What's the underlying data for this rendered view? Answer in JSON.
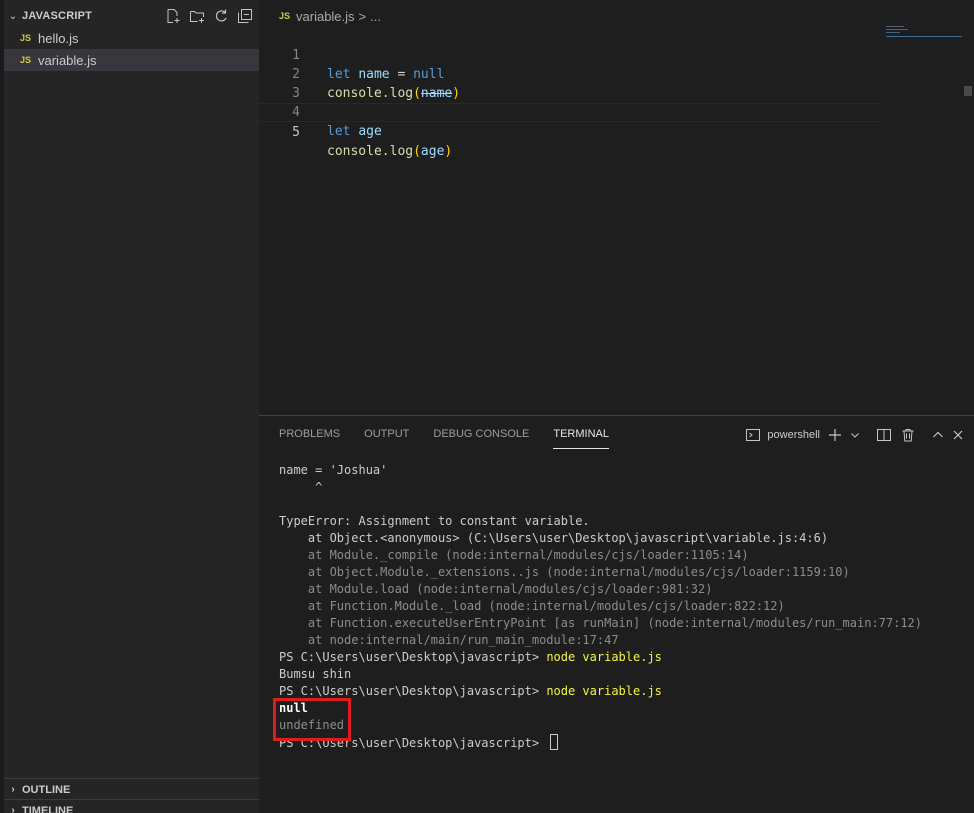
{
  "sidebar": {
    "header_title": "JAVASCRIPT",
    "files": [
      {
        "badge": "JS",
        "name": "hello.js"
      },
      {
        "badge": "JS",
        "name": "variable.js"
      }
    ],
    "outline_label": "OUTLINE",
    "timeline_label": "TIMELINE"
  },
  "editor": {
    "breadcrumb": {
      "badge": "JS",
      "file": "variable.js",
      "separator": ">",
      "more": "..."
    },
    "lines": [
      {
        "num": "1"
      },
      {
        "num": "2"
      },
      {
        "num": "3"
      },
      {
        "num": "4"
      },
      {
        "num": "5"
      }
    ],
    "code": {
      "l1_kw": "let",
      "l1_var": "name",
      "l1_eq": " = ",
      "l1_val": "null",
      "l2_fn": "console.log",
      "l2_open": "(",
      "l2_arg": "name",
      "l2_close": ")",
      "l4_kw": "let",
      "l4_var": "age",
      "l5_fn": "console.log",
      "l5_open": "(",
      "l5_arg": "age",
      "l5_close": ")"
    }
  },
  "panel": {
    "tabs": [
      "PROBLEMS",
      "OUTPUT",
      "DEBUG CONSOLE",
      "TERMINAL"
    ],
    "active_tab": "TERMINAL",
    "shell_name": "powershell",
    "terminal": {
      "l1": "name = 'Joshua'",
      "l2": "     ^",
      "l3": "",
      "l4": "TypeError: Assignment to constant variable.",
      "l5": "    at Object.<anonymous> (C:\\Users\\user\\Desktop\\javascript\\variable.js:4:6)",
      "l6": "    at Module._compile (node:internal/modules/cjs/loader:1105:14)",
      "l7": "    at Object.Module._extensions..js (node:internal/modules/cjs/loader:1159:10)",
      "l8": "    at Module.load (node:internal/modules/cjs/loader:981:32)",
      "l9": "    at Function.Module._load (node:internal/modules/cjs/loader:822:12)",
      "l10": "    at Function.executeUserEntryPoint [as runMain] (node:internal/modules/run_main:77:12)",
      "l11": "    at node:internal/main/run_main_module:17:47",
      "prompt": "PS C:\\Users\\user\\Desktop\\javascript> ",
      "cmd1": "node variable.js",
      "out1": "Bumsu shin",
      "cmd2": "node variable.js",
      "out2a": "null",
      "out2b": "undefined"
    }
  },
  "colors": {
    "highlight_box": "#e01c1c",
    "js_badge": "#cbcb41",
    "keyword": "#569cd6"
  }
}
